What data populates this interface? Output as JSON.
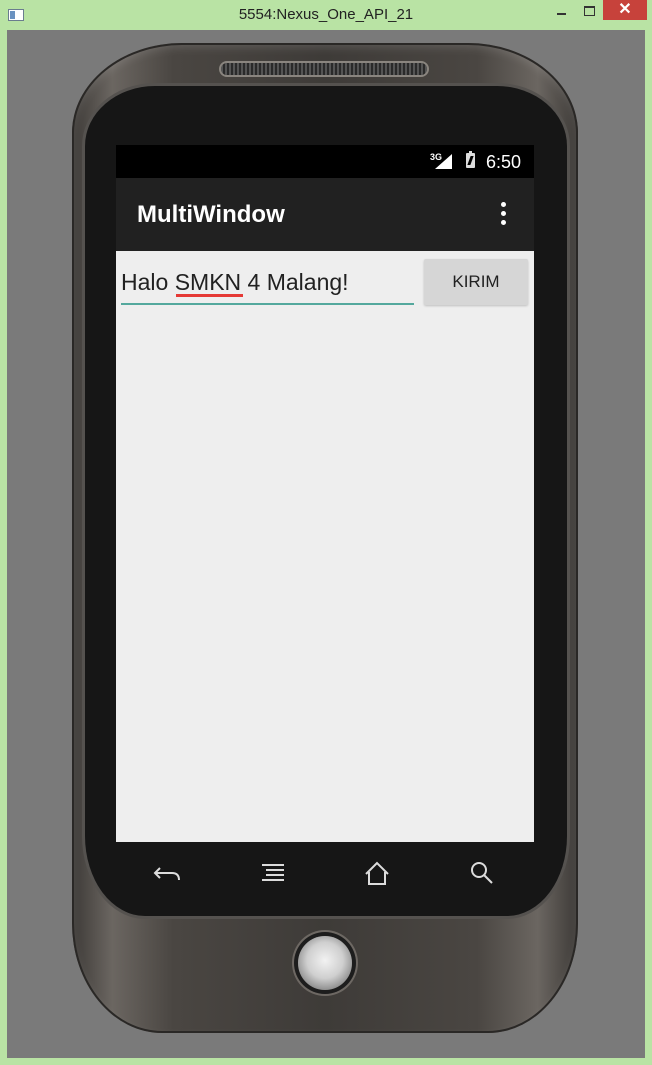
{
  "window": {
    "title": "5554:Nexus_One_API_21",
    "minimize_label": "",
    "close_label": "✕"
  },
  "statusbar": {
    "network": "3G",
    "time": "6:50"
  },
  "app": {
    "title": "MultiWindow"
  },
  "main": {
    "message_value": "Halo SMKN 4 Malang!",
    "send_label": "KIRIM"
  },
  "colors": {
    "accent": "#54a89d",
    "actionbar": "#212121",
    "background": "#eeeeee",
    "button": "#d6d6d6"
  }
}
